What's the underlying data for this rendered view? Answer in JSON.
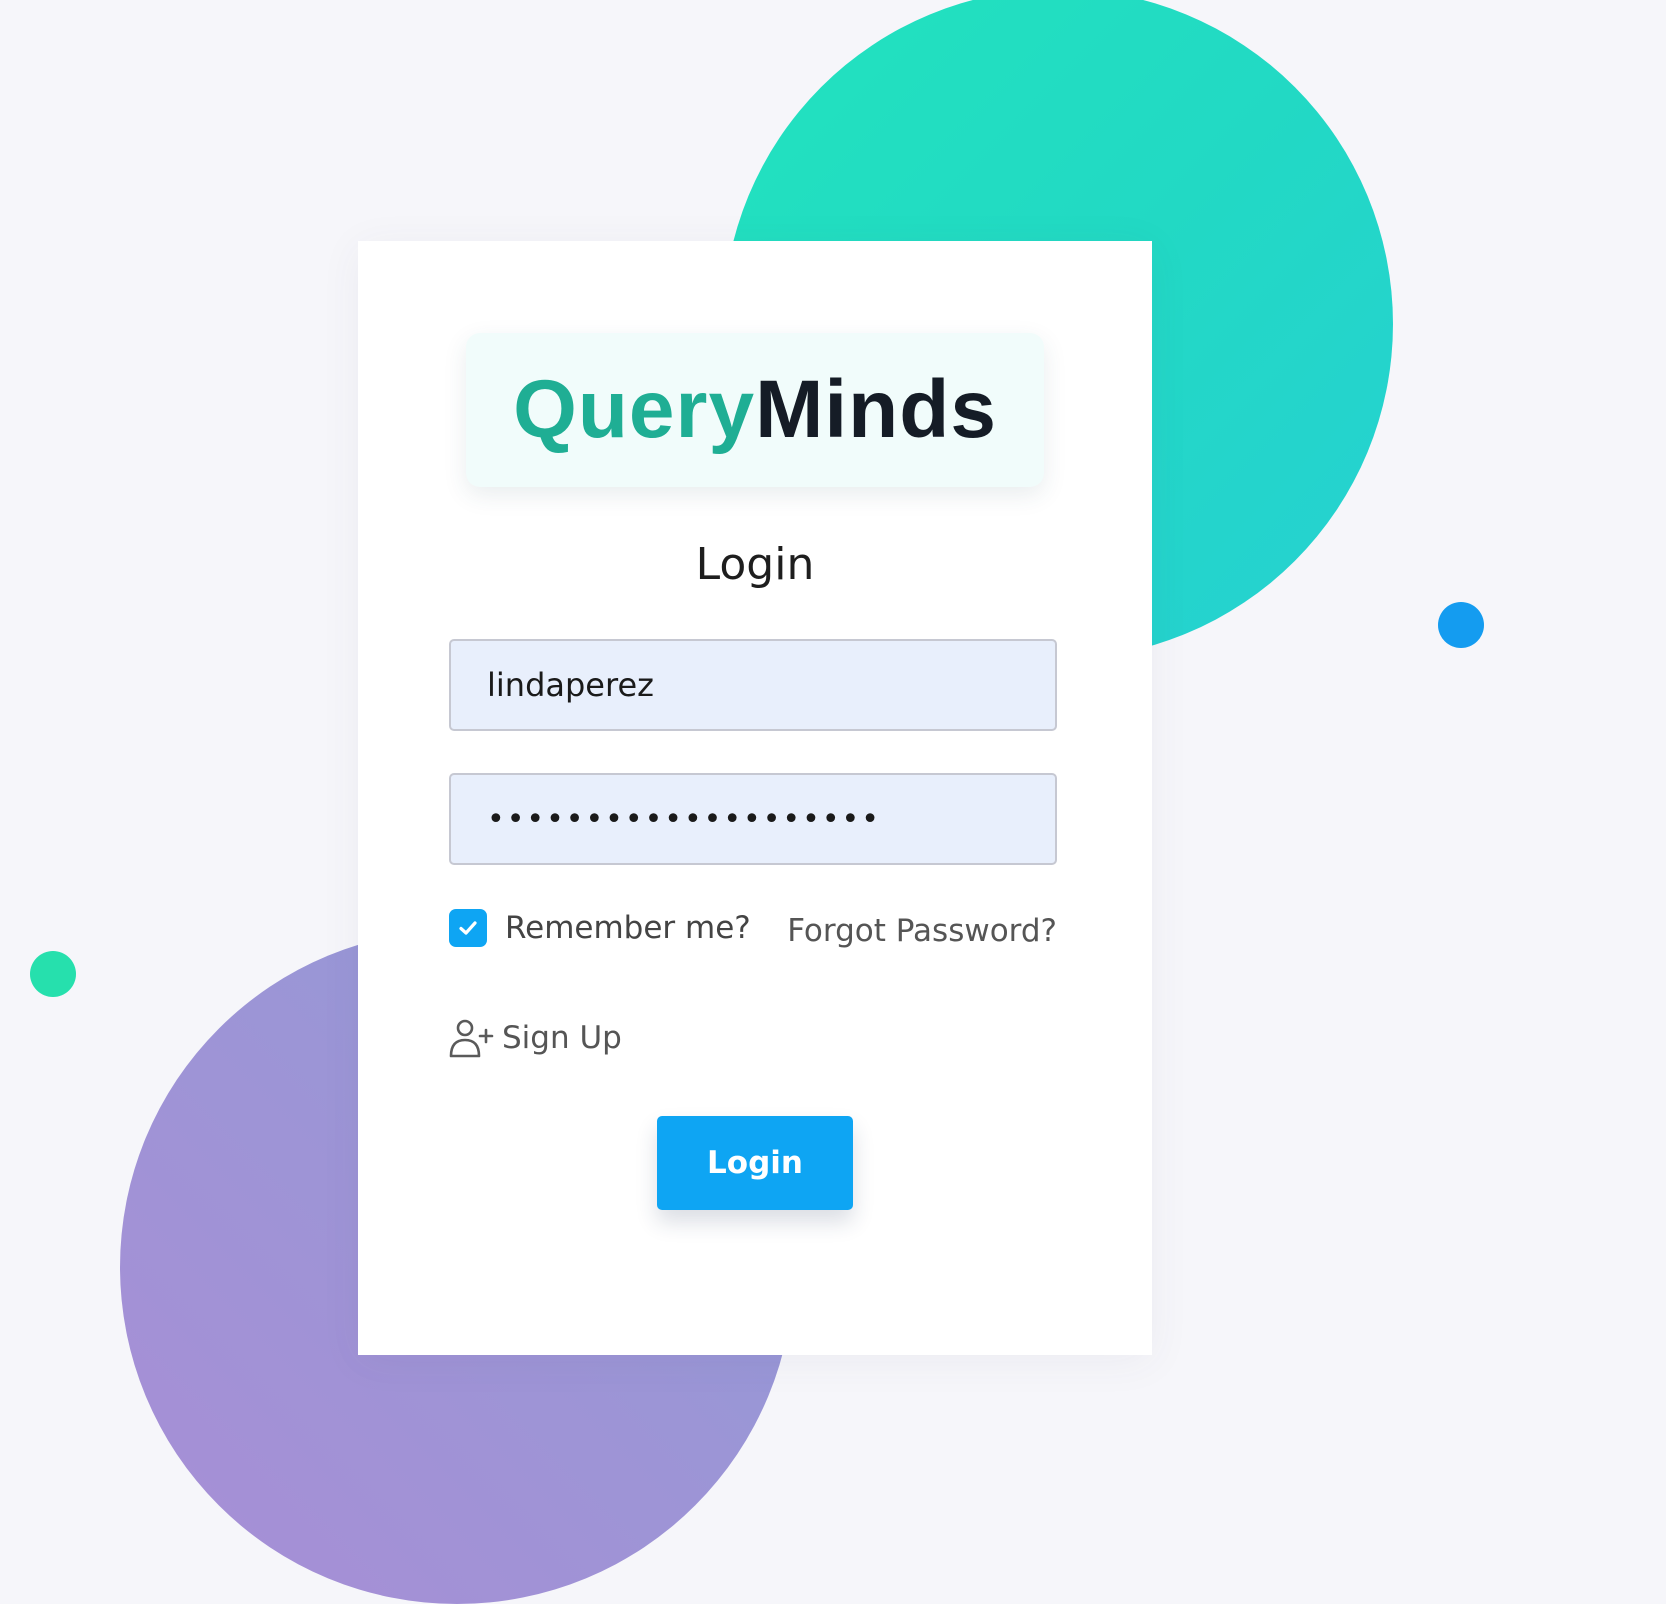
{
  "brand": {
    "part1": "Query",
    "part2": "Minds"
  },
  "title": "Login",
  "username": {
    "value": "lindaperez"
  },
  "password": {
    "value": "••••••••••••••••••••"
  },
  "remember": {
    "label": "Remember me?",
    "checked": true
  },
  "forgot_label": "Forgot Password?",
  "signup_label": "Sign Up",
  "login_button_label": "Login",
  "icons": {
    "checkbox": "check-icon",
    "signup": "user-plus-icon"
  },
  "colors": {
    "brand_teal": "#1fae94",
    "brand_dark": "#151c26",
    "accent_blue": "#0ea5f3",
    "input_bg": "#e8effc"
  }
}
